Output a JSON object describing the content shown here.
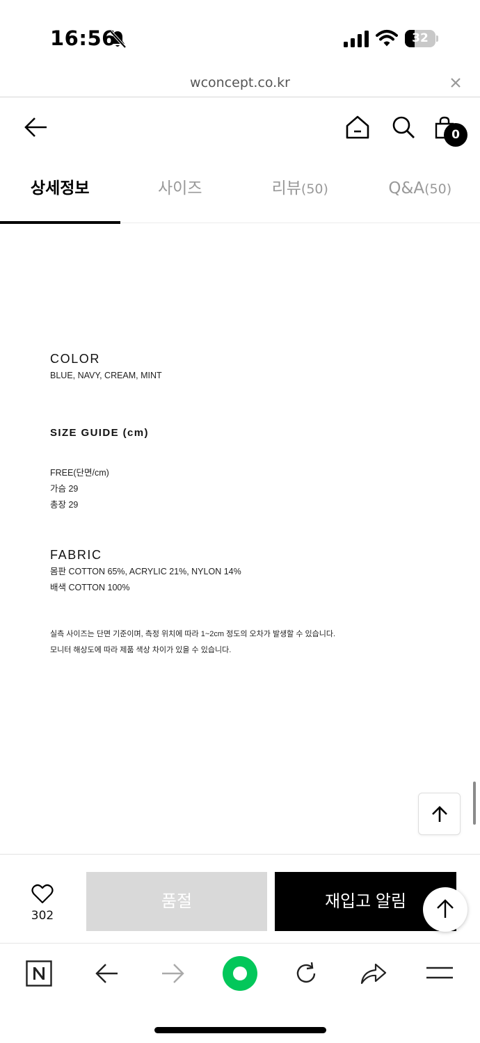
{
  "status_bar": {
    "time": "16:56",
    "battery_level": "32",
    "battery_fraction": 0.32
  },
  "url_bar": {
    "url": "wconcept.co.kr"
  },
  "header": {
    "cart_count": "0"
  },
  "tabs": [
    {
      "label": "상세정보",
      "count": ""
    },
    {
      "label": "사이즈",
      "count": ""
    },
    {
      "label": "리뷰",
      "count": "(50)"
    },
    {
      "label": "Q&A",
      "count": "(50)"
    }
  ],
  "content": {
    "color_title": "COLOR",
    "color_value": "BLUE, NAVY, CREAM, MINT",
    "size_title": "SIZE GUIDE (cm)",
    "size_lines": [
      "FREE(단면/cm)",
      "가슴 29",
      "총장 29"
    ],
    "fabric_title": "FABRIC",
    "fabric_lines": [
      "몸판 COTTON 65%, ACRYLIC 21%, NYLON 14%",
      "배색 COTTON 100%"
    ],
    "notes": [
      "실측 사이즈는 단면 기준이며, 측정 위치에 따라 1~2cm 정도의 오차가 발생할 수 있습니다.",
      "모니터 해상도에 따라 제품 색상 차이가 있을 수 있습니다."
    ]
  },
  "action_bar": {
    "like_count": "302",
    "soldout_label": "품절",
    "restock_label": "재입고 알림"
  },
  "colors": {
    "accent": "#000000",
    "soldout_bg": "#d9d9d9",
    "naver_green": "#03c75a"
  },
  "toolbar": {
    "icons": [
      "naver-n-icon",
      "back-arrow-icon",
      "forward-arrow-icon",
      "green-dot-icon",
      "reload-icon",
      "share-icon",
      "menu-icon"
    ]
  }
}
